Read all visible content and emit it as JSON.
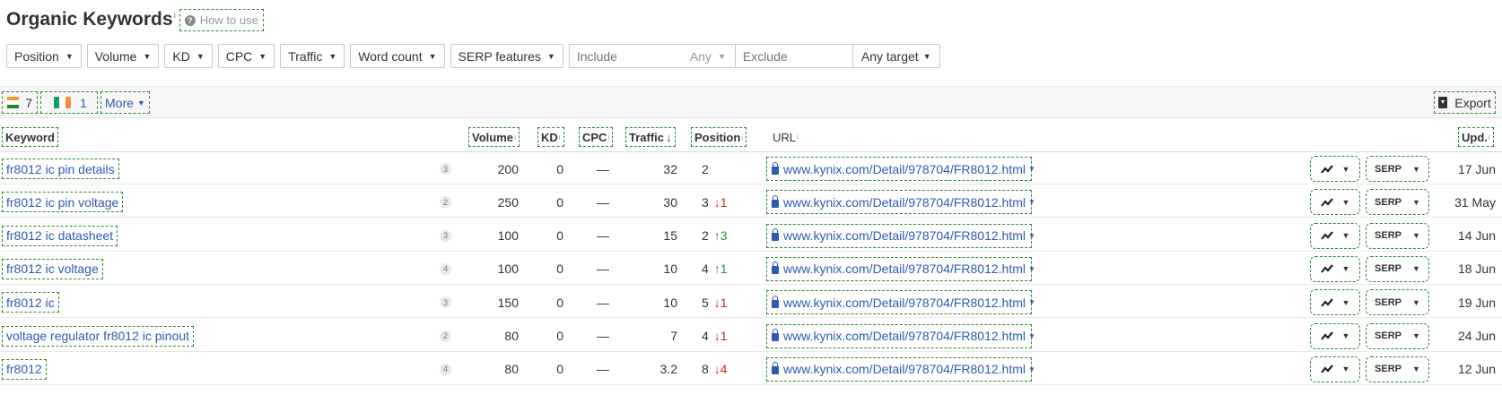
{
  "header": {
    "title": "Organic Keywords",
    "title_info": "i",
    "how_to_use": "How to use",
    "how_to_use_icon": "?"
  },
  "filters": {
    "buttons": [
      "Position",
      "Volume",
      "KD",
      "CPC",
      "Traffic",
      "Word count",
      "SERP features"
    ],
    "include_placeholder": "Include",
    "any_label": "Any",
    "exclude_placeholder": "Exclude",
    "target_label": "Any target"
  },
  "countries": [
    {
      "flag": "india-flag-icon",
      "count": "7"
    },
    {
      "flag": "ireland-flag-icon",
      "count": "1"
    }
  ],
  "more_label": "More",
  "export_label": "Export",
  "columns": {
    "keyword": "Keyword",
    "volume": "Volume",
    "kd": "KD",
    "cpc": "CPC",
    "traffic": "Traffic",
    "traffic_sort": "↓",
    "position": "Position",
    "url": "URL",
    "updated": "Upd.",
    "info": "i"
  },
  "rows": [
    {
      "keyword": "fr8012 ic pin details",
      "words": "3",
      "volume": "200",
      "kd": "0",
      "cpc": "—",
      "traffic": "32",
      "position": "2",
      "change": "",
      "dir": "",
      "url": "www.kynix.com/Detail/978704/FR8012.html",
      "serp": "SERP",
      "updated": "17 Jun"
    },
    {
      "keyword": "fr8012 ic pin voltage",
      "words": "2",
      "volume": "250",
      "kd": "0",
      "cpc": "—",
      "traffic": "30",
      "position": "3",
      "change": "↓1",
      "dir": "down",
      "url": "www.kynix.com/Detail/978704/FR8012.html",
      "serp": "SERP",
      "updated": "31 May"
    },
    {
      "keyword": "fr8012 ic datasheet",
      "words": "3",
      "volume": "100",
      "kd": "0",
      "cpc": "—",
      "traffic": "15",
      "position": "2",
      "change": "↑3",
      "dir": "up",
      "url": "www.kynix.com/Detail/978704/FR8012.html",
      "serp": "SERP",
      "updated": "14 Jun"
    },
    {
      "keyword": "fr8012 ic voltage",
      "words": "4",
      "volume": "100",
      "kd": "0",
      "cpc": "—",
      "traffic": "10",
      "position": "4",
      "change": "↑1",
      "dir": "up",
      "url": "www.kynix.com/Detail/978704/FR8012.html",
      "serp": "SERP",
      "updated": "18 Jun"
    },
    {
      "keyword": "fr8012 ic",
      "words": "3",
      "volume": "150",
      "kd": "0",
      "cpc": "—",
      "traffic": "10",
      "position": "5",
      "change": "↓1",
      "dir": "down",
      "url": "www.kynix.com/Detail/978704/FR8012.html",
      "serp": "SERP",
      "updated": "19 Jun"
    },
    {
      "keyword": "voltage regulator fr8012 ic pinout",
      "words": "2",
      "volume": "80",
      "kd": "0",
      "cpc": "—",
      "traffic": "7",
      "position": "4",
      "change": "↓1",
      "dir": "down",
      "url": "www.kynix.com/Detail/978704/FR8012.html",
      "serp": "SERP",
      "updated": "24 Jun"
    },
    {
      "keyword": "fr8012",
      "words": "4",
      "volume": "80",
      "kd": "0",
      "cpc": "—",
      "traffic": "3.2",
      "position": "8",
      "change": "↓4",
      "dir": "down",
      "url": "www.kynix.com/Detail/978704/FR8012.html",
      "serp": "SERP",
      "updated": "12 Jun"
    }
  ],
  "colors": {
    "link": "#2b5bb5",
    "up": "#1d9a3c",
    "down": "#d9261c",
    "annotation_border": "#2a8a2a"
  }
}
